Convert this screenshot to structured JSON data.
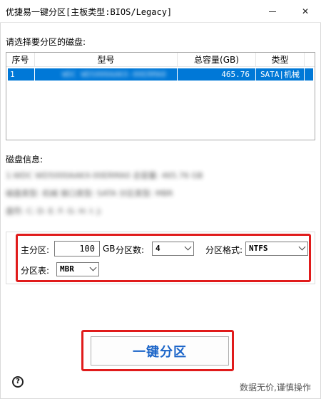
{
  "window": {
    "title": "优捷易一键分区[主板类型:BIOS/Legacy]",
    "minimize_glyph": "",
    "close_glyph": "✕"
  },
  "disk_list": {
    "prompt": "请选择要分区的磁盘:",
    "columns": [
      "序号",
      "型号",
      "总容量(GB)",
      "类型"
    ],
    "rows": [
      {
        "index": "1",
        "model": "WDC WD5000AAKX-00ERMA0",
        "capacity": "465.76",
        "type": "SATA|机械"
      }
    ]
  },
  "disk_info": {
    "title": "磁盘信息:",
    "lines": [
      "1:WDC WD5000AAKX-00ERMA0   总容量: 465.76 GB",
      "磁盘类型: 机械   接口类型: SATA   分区类型: MBR",
      "盘符: C: D: E: F: G: H: I: J:"
    ]
  },
  "partition": {
    "primary_label": "主分区:",
    "primary_value": "100",
    "unit": "GB",
    "count_label": "分区数:",
    "count_value": "4",
    "format_label": "分区格式:",
    "format_value": "NTFS",
    "table_label": "分区表:",
    "table_value": "MBR"
  },
  "actions": {
    "one_click_label": "一键分区",
    "help_glyph": "?"
  },
  "footer": {
    "note": "数据无价,谨慎操作"
  },
  "colors": {
    "accent_blue": "#1a64c8",
    "selection_blue": "#0078d7",
    "highlight_red": "#e01b1b"
  }
}
